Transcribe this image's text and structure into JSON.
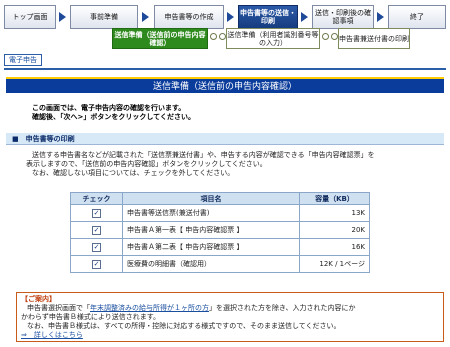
{
  "steps": [
    {
      "label": "トップ画面",
      "active": false
    },
    {
      "label": "事前準備",
      "active": false
    },
    {
      "label": "申告書等の作成",
      "active": false
    },
    {
      "label": "申告書等の送信・印刷",
      "active": true
    },
    {
      "label": "送信・印刷後の確認事項",
      "active": false
    },
    {
      "label": "終了",
      "active": false
    }
  ],
  "substeps": [
    {
      "label": "送信準備（送信前の申告内容確認）",
      "active": true
    },
    {
      "label": "送信準備（利用者識別番号等の入力）",
      "active": false
    },
    {
      "label": "申告書兼送付書の印刷",
      "active": false
    }
  ],
  "tag": "電子申告",
  "banner": "送信準備（送信前の申告内容確認）",
  "intro": {
    "line1": "この画面では、電子申告内容の確認を行います。",
    "line2": "確認後、「次へ>」ボタンをクリックしてください。"
  },
  "section_title": "■　申告書等の印刷",
  "desc": {
    "line1": "送信する申告書名などが記載された「送信票兼送付書」や、申告する内容が確認できる「申告内容確認票」を",
    "line2": "表示しますので、「送信前の申告内容確認」ボタンをクリックしてください。",
    "line3": "なお、確認しない項目については、チェックを外してください。"
  },
  "table": {
    "headers": {
      "check": "チェック",
      "item": "項目名",
      "size": "容量（KB）"
    },
    "rows": [
      {
        "item": "申告書等送信票(兼送付書)",
        "size": "13K",
        "checked": true
      },
      {
        "item": "申告書Ａ第一表【 申告内容確認票 】",
        "size": "20K",
        "checked": true
      },
      {
        "item": "申告書Ａ第二表【 申告内容確認票 】",
        "size": "16K",
        "checked": true
      },
      {
        "item": "医療費の明細書（確認用）",
        "size": "12K / 1ページ",
        "checked": true
      }
    ]
  },
  "notice": {
    "title": "【ご案内】",
    "line1a": "申告書選択画面で「",
    "line1_link": "年末調整済みの給与所得が１ヶ所の方",
    "line1b": "」を選択された方を除き、入力された内容にか",
    "line2": "かわらず申告書Ｂ様式により送信されます。",
    "line3": "なお、申告書Ｂ様式は、すべての所得・控除に対応する様式ですので、そのまま送信してください。",
    "more_link": "⇒　詳しくはこちら"
  },
  "colors": {
    "accent": "#0a3c9c",
    "active_sub": "#2f8a1e",
    "notice_border": "#c85a1a"
  }
}
